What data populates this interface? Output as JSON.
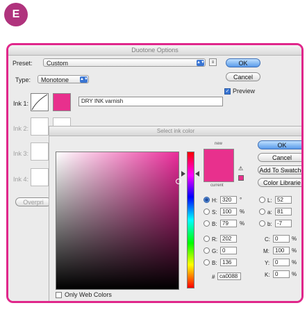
{
  "badge": {
    "letter": "E"
  },
  "duotone": {
    "title": "Duotone Options",
    "preset_label": "Preset:",
    "preset_value": "Custom",
    "type_label": "Type:",
    "type_value": "Monotone",
    "ink_labels": [
      "Ink 1:",
      "Ink 2:",
      "Ink 3:",
      "Ink 4:"
    ],
    "ink1_name": "DRY INK varnish",
    "ok_label": "OK",
    "cancel_label": "Cancel",
    "preview_label": "Preview",
    "overprint_label": "Overpri"
  },
  "ink_dialog": {
    "title": "Select ink color",
    "new_label": "new",
    "current_label": "current",
    "ok_label": "OK",
    "cancel_label": "Cancel",
    "add_swatches_label": "Add To Swatche",
    "color_libraries_label": "Color Librarie",
    "only_web_colors_label": "Only Web Colors",
    "selected_color": "#e8308d",
    "fields": {
      "H": {
        "label": "H:",
        "value": "320",
        "unit": "°"
      },
      "S": {
        "label": "S:",
        "value": "100",
        "unit": "%"
      },
      "B": {
        "label": "B:",
        "value": "79",
        "unit": "%"
      },
      "R": {
        "label": "R:",
        "value": "202"
      },
      "G": {
        "label": "G:",
        "value": "0"
      },
      "Bl": {
        "label": "B:",
        "value": "136"
      },
      "L": {
        "label": "L:",
        "value": "52"
      },
      "a": {
        "label": "a:",
        "value": "81"
      },
      "b": {
        "label": "b:",
        "value": "-7"
      },
      "C": {
        "label": "C:",
        "value": "0",
        "unit": "%"
      },
      "M": {
        "label": "M:",
        "value": "100",
        "unit": "%"
      },
      "Y": {
        "label": "Y:",
        "value": "0",
        "unit": "%"
      },
      "K": {
        "label": "K:",
        "value": "0",
        "unit": "%"
      },
      "hex": {
        "label": "#",
        "value": "ca0088"
      }
    }
  }
}
